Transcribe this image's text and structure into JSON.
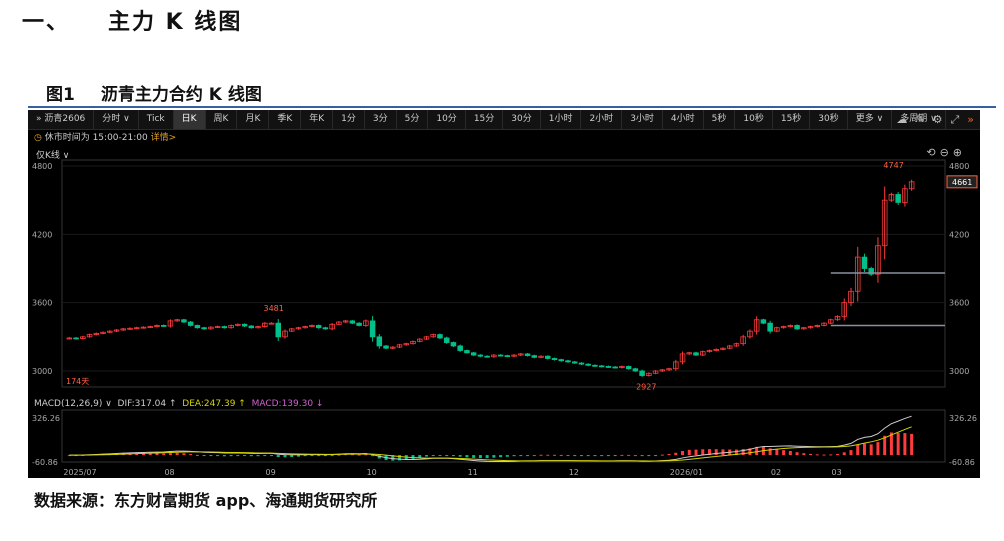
{
  "heading": {
    "num": "一、",
    "title": "主力 K 线图"
  },
  "figure": {
    "num": "图1",
    "title": "沥青主力合约 K 线图"
  },
  "toolbar": {
    "symbol": "沥青2606",
    "items": [
      "分时 ∨",
      "Tick",
      "日K",
      "周K",
      "月K",
      "季K",
      "年K",
      "1分",
      "3分",
      "5分",
      "10分",
      "15分",
      "30分",
      "1小时",
      "2小时",
      "3小时",
      "4小时",
      "5秒",
      "10秒",
      "15秒",
      "30秒",
      "更多 ∨",
      "多周期 ∨"
    ],
    "active": "日K",
    "icons": [
      "cloud-icon",
      "pencil-icon",
      "settings-icon",
      "fullscreen-icon",
      "collapse-icon"
    ]
  },
  "notice": {
    "text": "休市时间为 15:00-21:00",
    "link": "详情>"
  },
  "sub_label": "仅K线 ∨",
  "macd_header": {
    "name": "MACD(12,26,9) ∨",
    "dif": "DIF:317.04 ↑",
    "dea": "DEA:247.39 ↑",
    "macd": "MACD:139.30 ↓"
  },
  "source": "数据来源：东方财富期货 app、海通期货研究所",
  "colors": {
    "up": "#ff3b3b",
    "down": "#00c08b",
    "dif": "#cccccc",
    "dea": "#d4d400",
    "bg": "#000000"
  },
  "chart_data": {
    "type": "candlestick",
    "ylim": [
      2880,
      4880
    ],
    "yticks": [
      "4800",
      "4200",
      "3600",
      "3000"
    ],
    "macd_ticks": [
      "326.26",
      "-60.86"
    ],
    "macd_range": [
      -60.86,
      326.26
    ],
    "month_labels": [
      {
        "i": 0,
        "t": "2025/07"
      },
      {
        "i": 15,
        "t": "08"
      },
      {
        "i": 30,
        "t": "09"
      },
      {
        "i": 45,
        "t": "10"
      },
      {
        "i": 60,
        "t": "11"
      },
      {
        "i": 75,
        "t": "12"
      },
      {
        "i": 90,
        "t": "2026/01"
      },
      {
        "i": 105,
        "t": "02"
      },
      {
        "i": 114,
        "t": "03"
      }
    ],
    "annotations": {
      "high": "4747",
      "sep_high": "3481",
      "low": "2927",
      "days": "174天",
      "last": "4661"
    },
    "hlines": [
      3860,
      3400
    ],
    "closes": [
      3290,
      3285,
      3300,
      3320,
      3330,
      3340,
      3350,
      3360,
      3370,
      3375,
      3380,
      3385,
      3390,
      3400,
      3395,
      3440,
      3450,
      3430,
      3400,
      3380,
      3370,
      3385,
      3390,
      3380,
      3400,
      3410,
      3395,
      3380,
      3390,
      3420,
      3420,
      3300,
      3350,
      3370,
      3380,
      3390,
      3400,
      3380,
      3370,
      3410,
      3430,
      3440,
      3420,
      3400,
      3440,
      3300,
      3220,
      3200,
      3210,
      3230,
      3240,
      3260,
      3280,
      3300,
      3320,
      3290,
      3250,
      3220,
      3180,
      3160,
      3140,
      3130,
      3125,
      3140,
      3135,
      3130,
      3140,
      3150,
      3135,
      3120,
      3130,
      3110,
      3100,
      3090,
      3080,
      3070,
      3060,
      3050,
      3045,
      3040,
      3035,
      3030,
      3040,
      3020,
      3000,
      2960,
      2980,
      3000,
      3010,
      3020,
      3080,
      3150,
      3160,
      3140,
      3170,
      3180,
      3190,
      3200,
      3220,
      3240,
      3300,
      3350,
      3450,
      3420,
      3350,
      3380,
      3390,
      3400,
      3370,
      3380,
      3390,
      3400,
      3420,
      3450,
      3480,
      3600,
      3700,
      4000,
      3900,
      3850,
      4100,
      4500,
      4550,
      4480,
      4600,
      4661
    ]
  }
}
